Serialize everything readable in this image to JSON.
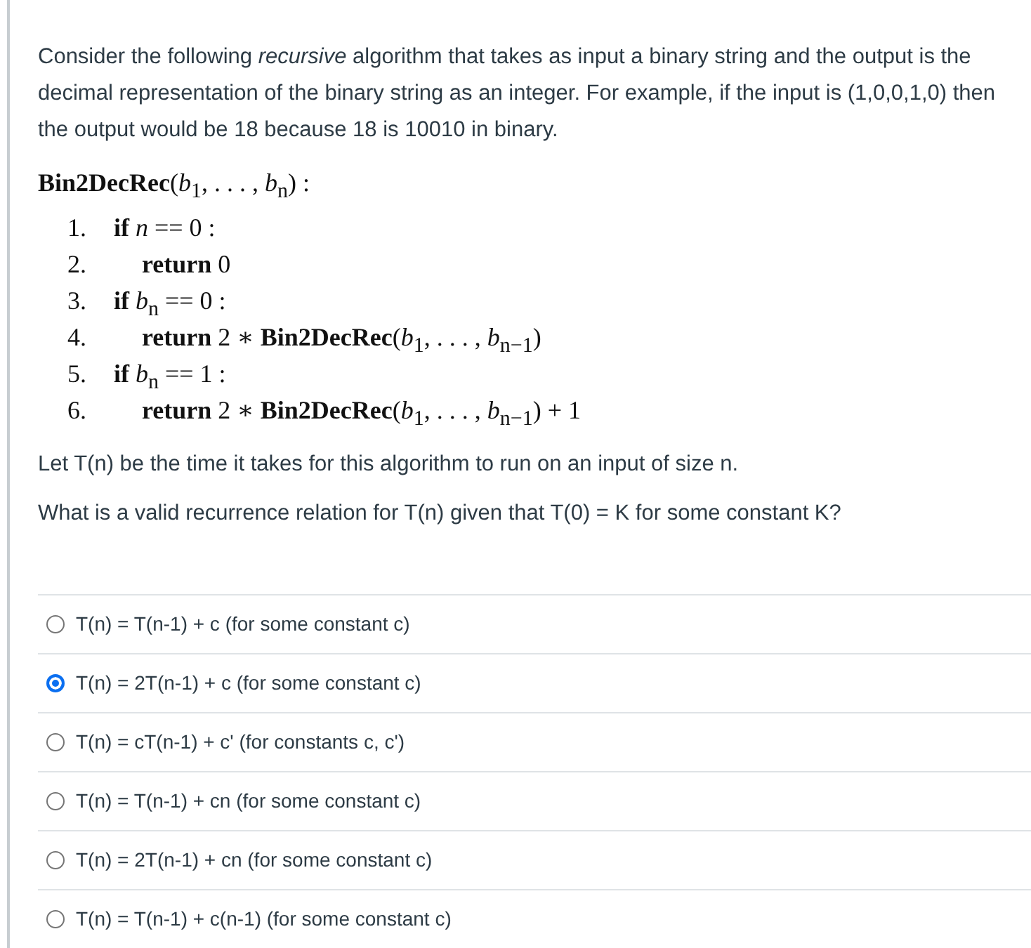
{
  "intro": "Consider the following *recursive* algorithm that takes as input a binary string and the output is the decimal representation of the binary string as an integer. For example, if the input is (1,0,0,1,0) then the output would be 18 because 18 is 10010 in binary.",
  "algorithm": {
    "header": "**Bin2DecRec**(*b*$_{1}$, . . . , *b*$_{n}$) :",
    "lines": [
      {
        "number": "1.",
        "text": "**if** *n* == 0 :",
        "children": [
          {
            "number": "2.",
            "text": "**return** 0"
          }
        ]
      },
      {
        "number": "3.",
        "text": "**if** *b*$_{n}$ == 0 :",
        "children": [
          {
            "number": "4.",
            "text": "**return** 2 ∗ **Bin2DecRec**(*b*$_{1}$, . . . , *b*$_{n−1}$)"
          }
        ]
      },
      {
        "number": "5.",
        "text": "**if** *b*$_{n}$ == 1 :",
        "children": [
          {
            "number": "6.",
            "text": "**return** 2 ∗ **Bin2DecRec**(*b*$_{1}$, . . . , *b*$_{n−1}$) + 1"
          }
        ]
      }
    ]
  },
  "paragraphs": [
    "Let T(n) be the time it takes for this algorithm to run on an input of size n.",
    "What is a valid recurrence relation for T(n) given that T(0) = K for some constant K?"
  ],
  "options": [
    {
      "label": "T(n) = T(n-1) + c (for some constant c)",
      "selected": false
    },
    {
      "label": "T(n) = 2T(n-1) + c (for some constant c)",
      "selected": true
    },
    {
      "label": "T(n) = cT(n-1) + c' (for constants c, c')",
      "selected": false
    },
    {
      "label": "T(n) = T(n-1) + cn (for some constant c)",
      "selected": false
    },
    {
      "label": "T(n) = 2T(n-1) + cn (for some constant c)",
      "selected": false
    },
    {
      "label": "T(n) = T(n-1) + c(n-1) (for some constant c)",
      "selected": false
    }
  ]
}
